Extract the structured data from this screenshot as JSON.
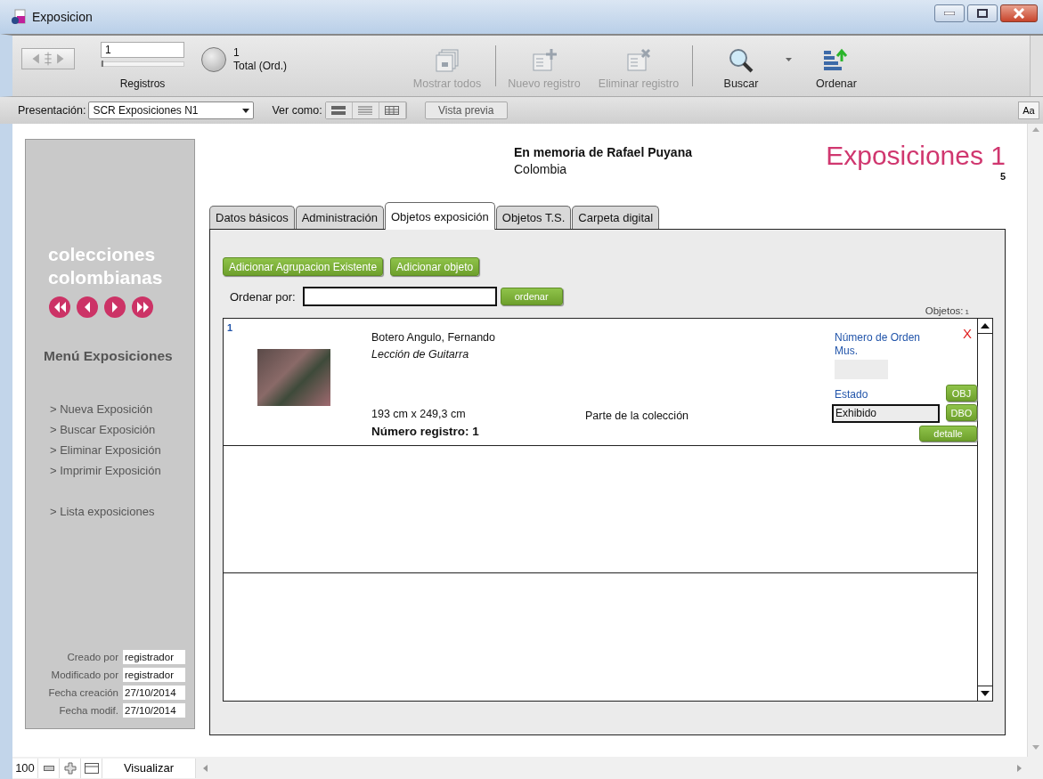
{
  "window": {
    "title": "Exposicion"
  },
  "toolbar": {
    "record_field": "1",
    "record_slider": {
      "level": 0
    },
    "records_label": "Registros",
    "found": "1",
    "total": "Total (Ord.)",
    "buttons": [
      {
        "kind": "show-all",
        "label": "Mostrar todos",
        "disabled": true
      },
      {
        "kind": "new",
        "label": "Nuevo registro",
        "disabled": true
      },
      {
        "kind": "delete",
        "label": "Eliminar registro",
        "disabled": true
      },
      {
        "kind": "search",
        "label": "Buscar",
        "disabled": false
      },
      {
        "kind": "sort",
        "label": "Ordenar",
        "disabled": false
      }
    ]
  },
  "layout_bar": {
    "presentation_label": "Presentación:",
    "presentation": "SCR Exposiciones N1",
    "view_label": "Ver como:",
    "preview_button": "Vista previa",
    "text_button": "Aa"
  },
  "sidebar": {
    "brand": "colecciones colombianas",
    "menu_title": "Menú Exposiciones",
    "menu_items": [
      "> Nueva Exposición",
      "> Buscar Exposición",
      "> Eliminar Exposición",
      "> Imprimir Exposición"
    ],
    "extra_items": [
      "> Lista exposiciones"
    ],
    "meta": [
      {
        "label": "Creado por",
        "value": "registrador"
      },
      {
        "label": "Modificado por",
        "value": "registrador"
      },
      {
        "label": "Fecha creación",
        "value": "27/10/2014"
      },
      {
        "label": "Fecha modif.",
        "value": "27/10/2014"
      }
    ]
  },
  "header": {
    "title": "En memoria de Rafael Puyana",
    "subtitle": "Colombia",
    "heading": "Exposiciones 1",
    "number": "5"
  },
  "tabs": [
    {
      "label": "Datos básicos",
      "selected": false
    },
    {
      "label": "Administración",
      "selected": false
    },
    {
      "label": "Objetos exposición",
      "selected": true
    },
    {
      "label": "Objetos T.S.",
      "selected": false
    },
    {
      "label": "Carpeta digital",
      "selected": false
    }
  ],
  "panel": {
    "buttons": [
      "Adicionar Agrupacion Existente",
      "Adicionar objeto"
    ],
    "sort_label": "Ordenar por:",
    "sort_button": "ordenar",
    "count_label": "Objetos:",
    "count": "1",
    "rows": [
      {
        "number": "1",
        "artist": "Botero Angulo, Fernando",
        "title": "Lección de Guitarra",
        "dimensions": "193 cm x 249,3 cm",
        "registry": "Número registro: 1",
        "status_note": "Parte de la colección",
        "delete": "X",
        "order_label": "Número de Orden Mus.",
        "state_label": "Estado",
        "state": "Exhibido",
        "buttons": [
          "OBJ",
          "DBO",
          "detalle"
        ]
      }
    ]
  },
  "status_bar": {
    "zoom": "100",
    "mode": "Visualizar"
  }
}
